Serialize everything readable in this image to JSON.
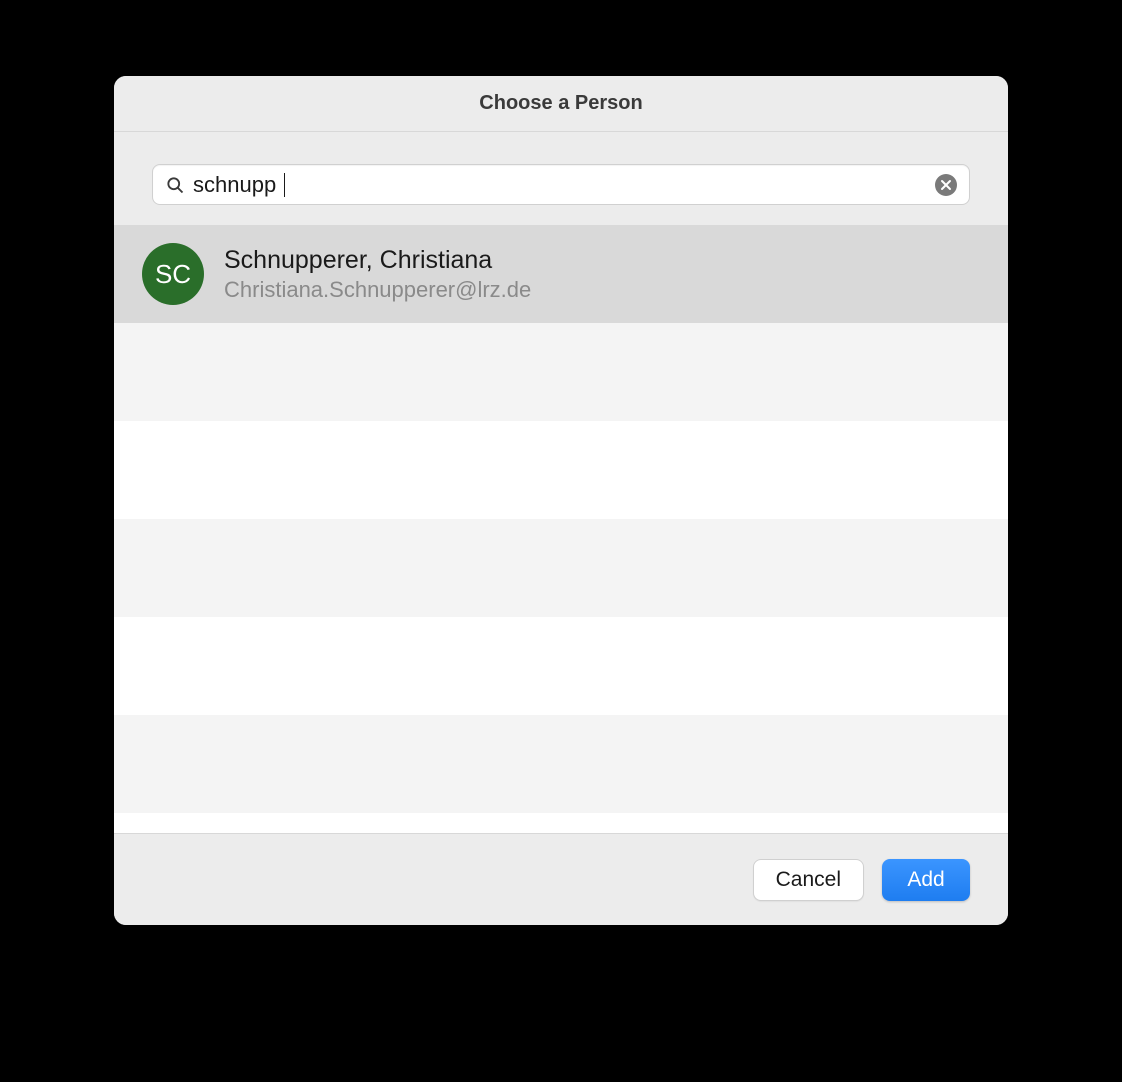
{
  "dialog": {
    "title": "Choose a Person"
  },
  "search": {
    "value": "schnupp"
  },
  "results": [
    {
      "initials": "SC",
      "name": "Schnupperer, Christiana",
      "email": "Christiana.Schnupperer@lrz.de",
      "selected": true
    }
  ],
  "buttons": {
    "cancel": "Cancel",
    "add": "Add"
  },
  "colors": {
    "avatar_bg": "#2a6e2a",
    "primary_button": "#1e7df0"
  }
}
